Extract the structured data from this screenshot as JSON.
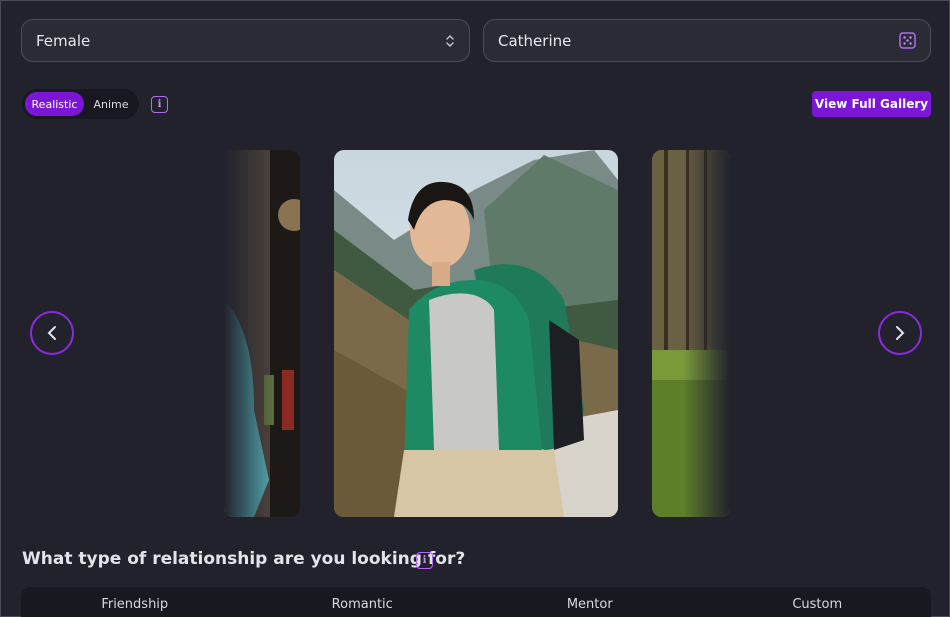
{
  "form": {
    "gender": {
      "value": "Female",
      "icon": "chevron-up-down-icon"
    },
    "name": {
      "value": "Catherine",
      "icon": "dice-icon"
    }
  },
  "style_toggle": {
    "options": [
      {
        "label": "Realistic",
        "selected": true
      },
      {
        "label": "Anime",
        "selected": false
      }
    ]
  },
  "gallery_button": {
    "label": "View Full Gallery"
  },
  "carousel": {
    "prev_icon": "chevron-left-icon",
    "next_icon": "chevron-right-icon"
  },
  "relationship": {
    "question": "What type of relationship are you looking for?",
    "options": [
      "Friendship",
      "Romantic",
      "Mentor",
      "Custom"
    ]
  },
  "colors": {
    "accent": "#7c16d6",
    "background": "#21222c",
    "panel": "#181920"
  }
}
